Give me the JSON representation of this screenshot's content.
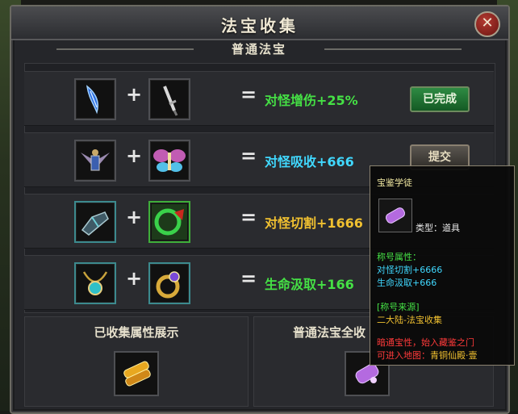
{
  "window": {
    "title": "法宝收集",
    "close_label": "✕"
  },
  "section": {
    "subtitle": "普通法宝"
  },
  "rows": [
    {
      "item_a": "blue-blade-icon",
      "item_b": "sword-icon",
      "plus": "+",
      "equals": "=",
      "effect": "对怪增伤+25%",
      "effect_color": "#45e045",
      "button": "已完成",
      "button_state": "completed"
    },
    {
      "item_a": "winged-armor-icon",
      "item_b": "fairy-wings-icon",
      "plus": "+",
      "equals": "=",
      "effect": "对怪吸收+666",
      "effect_color": "#40d8ff",
      "button": "提交",
      "button_state": "submit"
    },
    {
      "item_a": "gauntlet-icon",
      "item_b": "green-bracelet-icon",
      "plus": "+",
      "equals": "=",
      "effect": "对怪切割+1666",
      "effect_color": "#f0c030",
      "button": "",
      "button_state": "none"
    },
    {
      "item_a": "necklace-icon",
      "item_b": "gold-ring-icon",
      "plus": "+",
      "equals": "=",
      "effect": "生命汲取+166",
      "effect_color": "#45e045",
      "button": "",
      "button_state": "none"
    }
  ],
  "bottom": {
    "left_title": "已收集属性展示",
    "left_icon": "gold-scroll-icon",
    "right_title": "普通法宝全收",
    "right_icon": "purple-scroll-icon"
  },
  "tooltip": {
    "name": "宝鉴学徒",
    "icon": "purple-scroll-icon",
    "type_label": "类型：道具",
    "attr_header": "称号属性：",
    "attr_1": "对怪切割+6666",
    "attr_2": "生命汲取+666",
    "source_header": "[称号来源]",
    "source_value": "二大陆-法宝收集",
    "hint_1": "暗通宝性，始入藏鉴之门",
    "hint_2_label": "可进入地图：",
    "hint_2_value": "青铜仙殿·壹"
  }
}
